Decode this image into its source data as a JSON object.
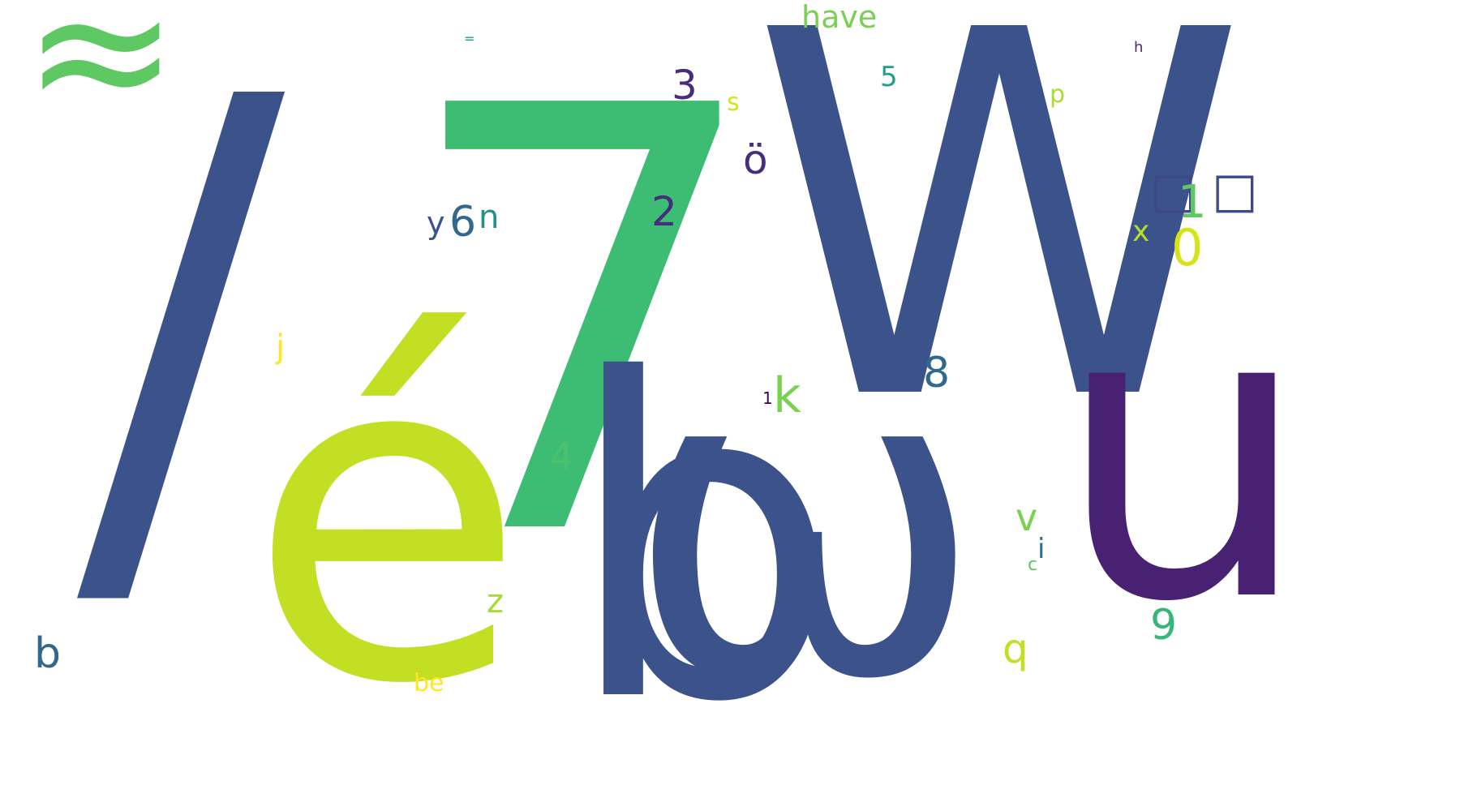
{
  "words": {
    "slash": {
      "text": "/",
      "color": "#3b528b"
    },
    "approx": {
      "text": "≈",
      "color": "#5ec962"
    },
    "seven": {
      "text": "7",
      "color": "#3dbc74"
    },
    "e_acute": {
      "text": "é",
      "color": "#c2df23"
    },
    "b_large": {
      "text": "b",
      "color": "#3b528b"
    },
    "omega": {
      "text": "ω",
      "color": "#3b528b"
    },
    "W": {
      "text": "W",
      "color": "#3b528b"
    },
    "u_large": {
      "text": "u",
      "color": "#482173"
    },
    "have": {
      "text": "have",
      "color": "#7ad151"
    },
    "three": {
      "text": "3",
      "color": "#472d7b"
    },
    "s": {
      "text": "s",
      "color": "#d8e219"
    },
    "five": {
      "text": "5",
      "color": "#1f9e89"
    },
    "p": {
      "text": "p",
      "color": "#a8db34"
    },
    "h": {
      "text": "h",
      "color": "#482878"
    },
    "o_umlaut": {
      "text": "ö",
      "color": "#472d7b"
    },
    "two": {
      "text": "2",
      "color": "#472d7b"
    },
    "y": {
      "text": "y",
      "color": "#3b528b"
    },
    "six": {
      "text": "6",
      "color": "#31688e"
    },
    "n": {
      "text": "n",
      "color": "#21918c"
    },
    "box_left": {
      "text": "□",
      "color": "#3e4989"
    },
    "one_big": {
      "text": "1",
      "color": "#5ec962"
    },
    "box_right": {
      "text": "□",
      "color": "#3e4989"
    },
    "x": {
      "text": "x",
      "color": "#b5de2b"
    },
    "zero": {
      "text": "0",
      "color": "#d8e219"
    },
    "j": {
      "text": "j",
      "color": "#fde725"
    },
    "eight": {
      "text": "8",
      "color": "#31688e"
    },
    "one_small": {
      "text": "1",
      "color": "#440154"
    },
    "k": {
      "text": "k",
      "color": "#7ad151"
    },
    "four": {
      "text": "4",
      "color": "#4ac16d"
    },
    "v": {
      "text": "v",
      "color": "#7ad151"
    },
    "i": {
      "text": "i",
      "color": "#2c728e"
    },
    "c": {
      "text": "c",
      "color": "#5ec962"
    },
    "nine": {
      "text": "9",
      "color": "#35b779"
    },
    "q": {
      "text": "q",
      "color": "#c2df23"
    },
    "z": {
      "text": "z",
      "color": "#a8db34"
    },
    "b_small": {
      "text": "b",
      "color": "#31688e"
    },
    "be": {
      "text": "be",
      "color": "#fde725"
    },
    "equals": {
      "text": "=",
      "color": "#1f9e89"
    }
  }
}
